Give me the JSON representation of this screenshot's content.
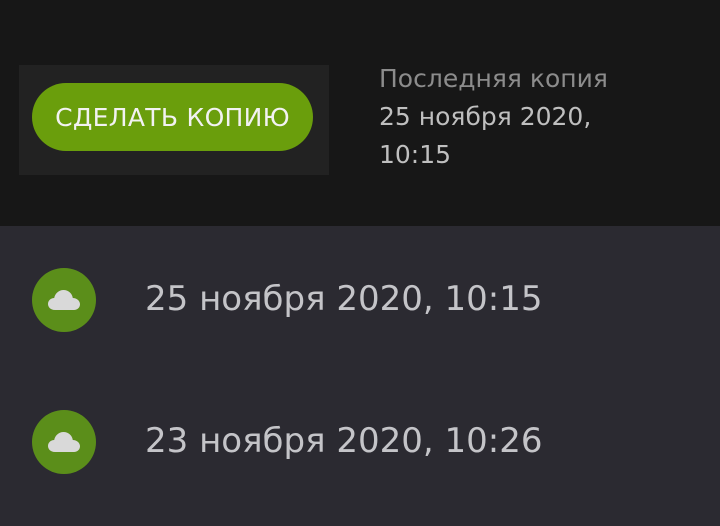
{
  "header": {
    "backup_button_label": "СДЕЛАТЬ КОПИЮ",
    "last_copy_label": "Последняя копия",
    "last_copy_value_line1": "25 ноября 2020,",
    "last_copy_value_line2": "10:15"
  },
  "backups": [
    {
      "date": "25 ноября 2020, 10:15",
      "icon": "cloud-icon"
    },
    {
      "date": "23 ноября 2020, 10:26",
      "icon": "cloud-icon"
    }
  ],
  "colors": {
    "accent": "#6a9e0c",
    "icon_bg": "#5b8e1a",
    "panel_bg": "#171717",
    "list_bg": "#2b2a31"
  }
}
